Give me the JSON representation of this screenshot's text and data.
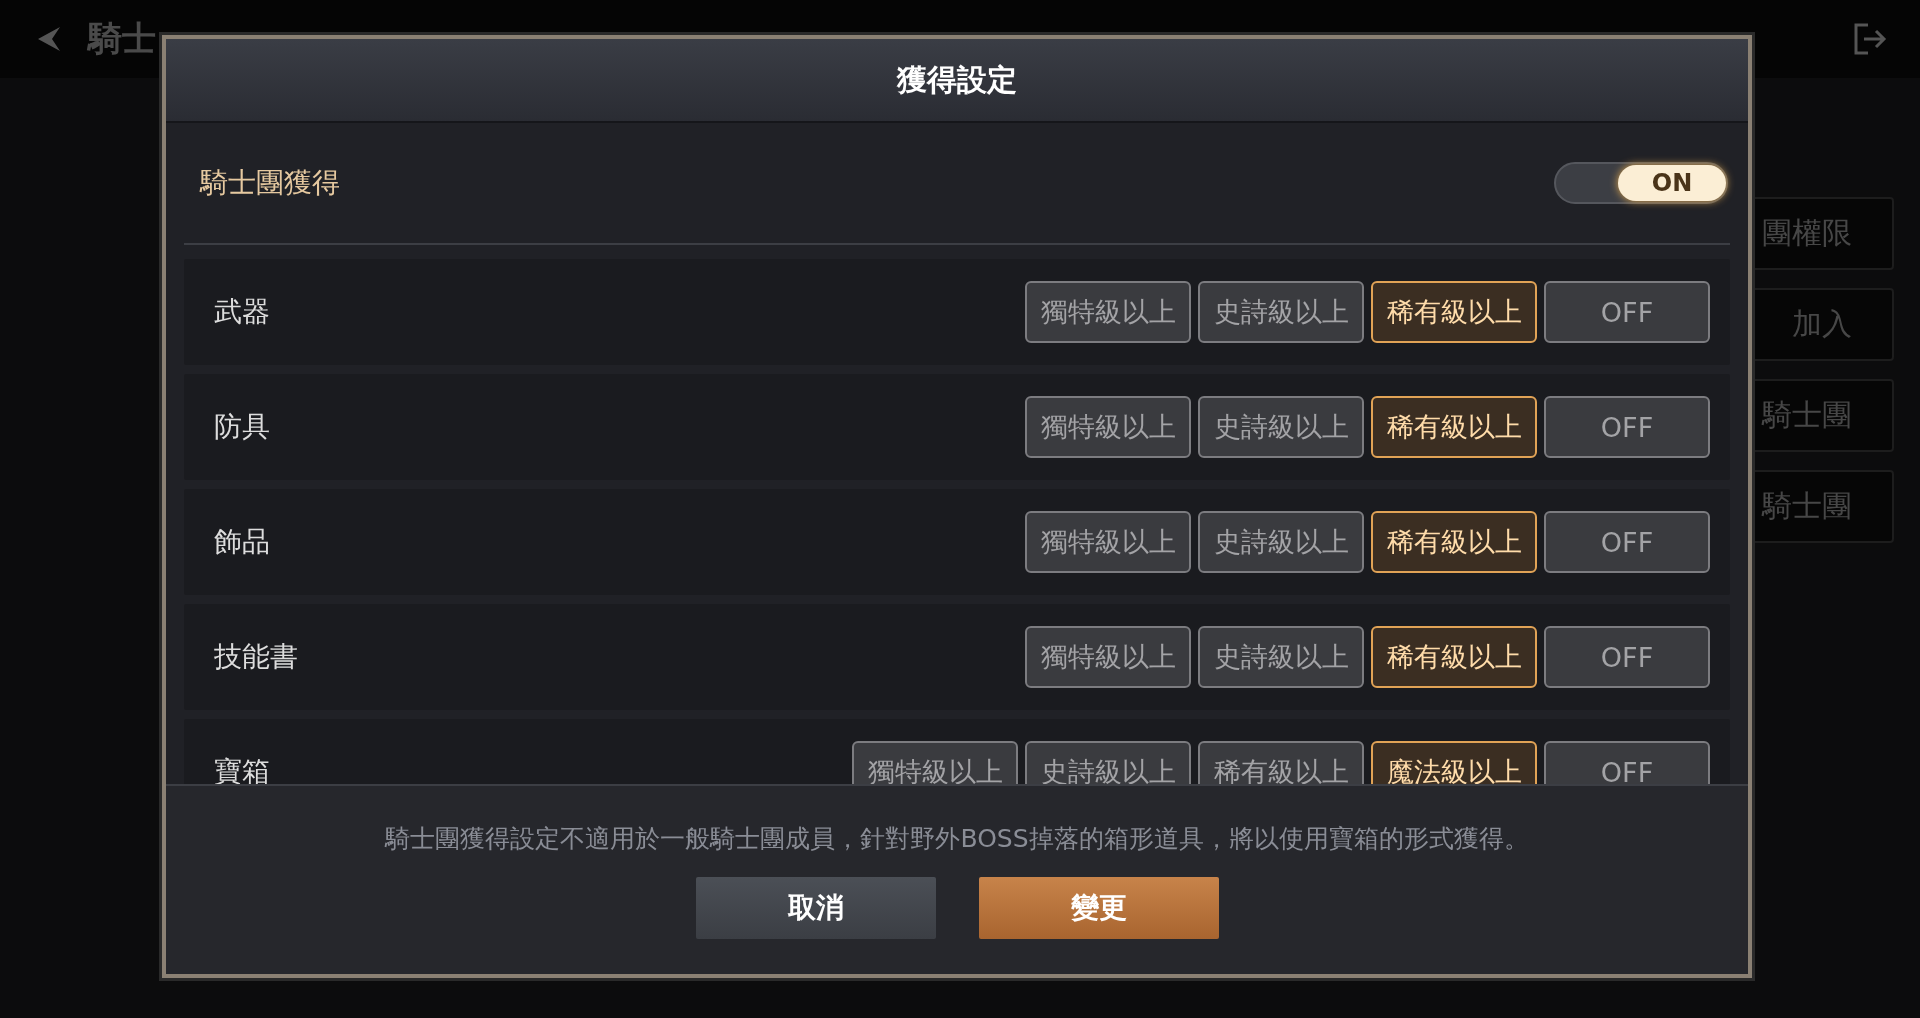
{
  "background": {
    "title": "騎士",
    "side_buttons": [
      "團權限",
      "加入",
      "騎士團",
      "騎士團"
    ]
  },
  "dialog": {
    "title": "獲得設定",
    "master": {
      "label": "騎士團獲得",
      "on": true,
      "state_label": "ON"
    },
    "categories": [
      {
        "label": "武器",
        "options": [
          {
            "label": "獨特級以上",
            "selected": false
          },
          {
            "label": "史詩級以上",
            "selected": false
          },
          {
            "label": "稀有級以上",
            "selected": true
          },
          {
            "label": "OFF",
            "selected": false
          }
        ]
      },
      {
        "label": "防具",
        "options": [
          {
            "label": "獨特級以上",
            "selected": false
          },
          {
            "label": "史詩級以上",
            "selected": false
          },
          {
            "label": "稀有級以上",
            "selected": true
          },
          {
            "label": "OFF",
            "selected": false
          }
        ]
      },
      {
        "label": "飾品",
        "options": [
          {
            "label": "獨特級以上",
            "selected": false
          },
          {
            "label": "史詩級以上",
            "selected": false
          },
          {
            "label": "稀有級以上",
            "selected": true
          },
          {
            "label": "OFF",
            "selected": false
          }
        ]
      },
      {
        "label": "技能書",
        "options": [
          {
            "label": "獨特級以上",
            "selected": false
          },
          {
            "label": "史詩級以上",
            "selected": false
          },
          {
            "label": "稀有級以上",
            "selected": true
          },
          {
            "label": "OFF",
            "selected": false
          }
        ]
      },
      {
        "label": "寶箱",
        "options": [
          {
            "label": "獨特級以上",
            "selected": false
          },
          {
            "label": "史詩級以上",
            "selected": false
          },
          {
            "label": "稀有級以上",
            "selected": false
          },
          {
            "label": "魔法級以上",
            "selected": true
          },
          {
            "label": "OFF",
            "selected": false
          }
        ]
      }
    ],
    "note": "騎士團獲得設定不適用於一般騎士團成員，針對野外BOSS掉落的箱形道具，將以使用寶箱的形式獲得。",
    "buttons": [
      {
        "label": "取消",
        "kind": "secondary"
      },
      {
        "label": "變更",
        "kind": "primary"
      }
    ]
  }
}
